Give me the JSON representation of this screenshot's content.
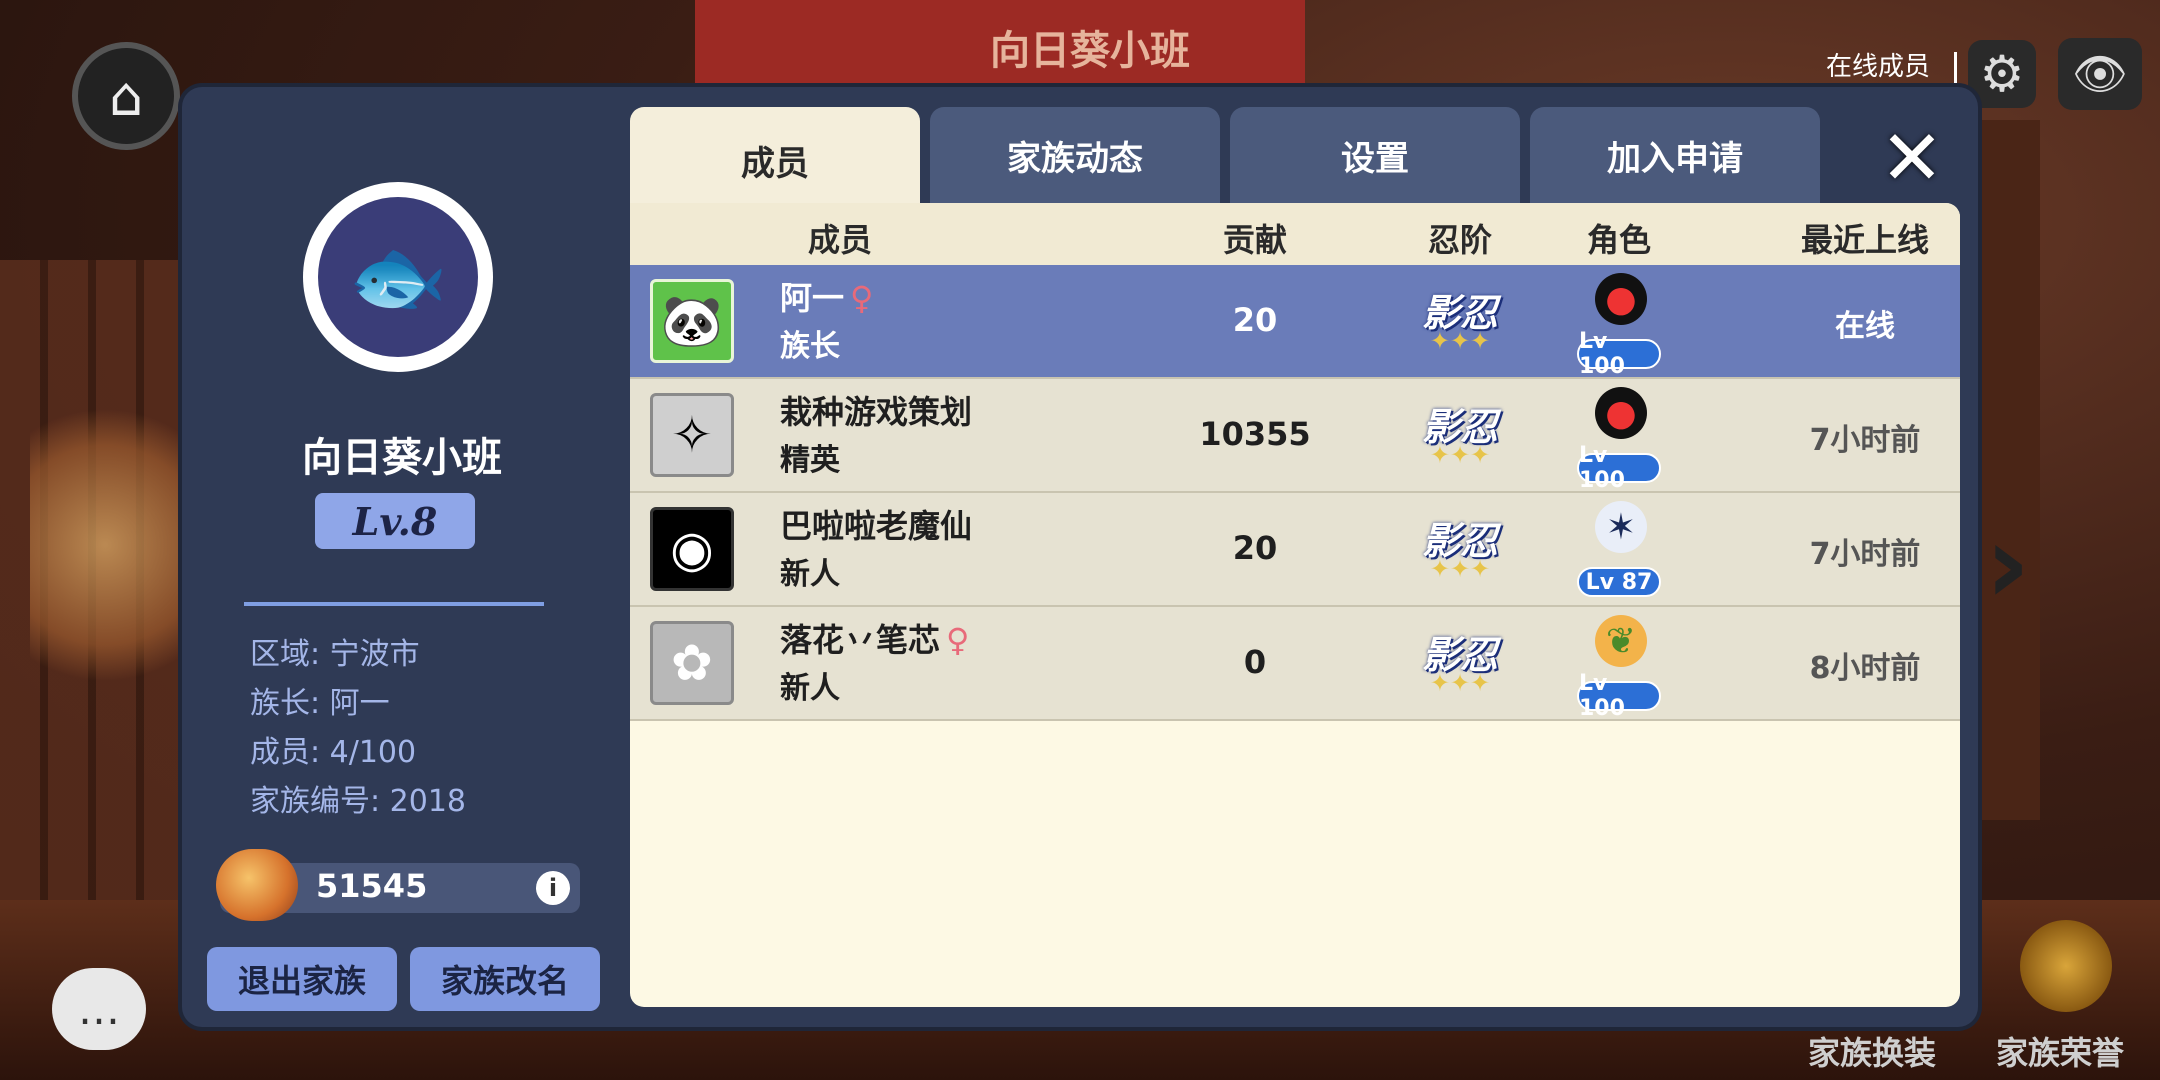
{
  "background_banner_title": "向日葵小班",
  "top_right": {
    "online_label": "在线成员"
  },
  "bottom_right": {
    "outfit_label": "家族换装",
    "honor_label": "家族荣誉"
  },
  "colors": {
    "panel": "#2f3a55",
    "accent": "#7f98e0",
    "table_bg": "#fdf9e4",
    "highlight_row": "#6a7cb9",
    "level_badge": "#2c6fd6",
    "female": "#e86a7a"
  },
  "family": {
    "name": "向日葵小班",
    "level": "Lv.8",
    "region": "区域: 宁波市",
    "leader": "族长: 阿一",
    "members": "成员: 4/100",
    "family_id": "家族编号: 2018",
    "funds": "51545",
    "quit_button": "退出家族",
    "rename_button": "家族改名"
  },
  "tabs": [
    {
      "label": "成员",
      "active": true
    },
    {
      "label": "家族动态",
      "active": false
    },
    {
      "label": "设置",
      "active": false
    },
    {
      "label": "加入申请",
      "active": false
    }
  ],
  "table": {
    "headers": {
      "member": "成员",
      "contribution": "贡献",
      "ninja_rank": "忍阶",
      "character": "角色",
      "last_online": "最近上线"
    },
    "rows": [
      {
        "name": "阿一",
        "gender": "♀",
        "rank": "族长",
        "contribution": "20",
        "ninja_rank": "影忍",
        "character_level": "Lv 100",
        "last_online": "在线",
        "avatar_icon": "panda-avatar-icon",
        "char_icon": "red-ninja-icon"
      },
      {
        "name": "栽种游戏策划",
        "gender": "",
        "rank": "精英",
        "contribution": "10355",
        "ninja_rank": "影忍",
        "character_level": "Lv 100",
        "last_online": "7小时前",
        "avatar_icon": "sketch-avatar-icon",
        "char_icon": "red-ninja-icon"
      },
      {
        "name": "巴啦啦老魔仙",
        "gender": "",
        "rank": "新人",
        "contribution": "20",
        "ninja_rank": "影忍",
        "character_level": "Lv 87",
        "last_online": "7小时前",
        "avatar_icon": "eye-avatar-icon",
        "char_icon": "spiky-hair-icon"
      },
      {
        "name": "落花丷笔芯",
        "gender": "♀",
        "rank": "新人",
        "contribution": "0",
        "ninja_rank": "影忍",
        "character_level": "Lv 100",
        "last_online": "8小时前",
        "avatar_icon": "flower-avatar-icon",
        "char_icon": "orange-fruit-icon"
      }
    ]
  }
}
